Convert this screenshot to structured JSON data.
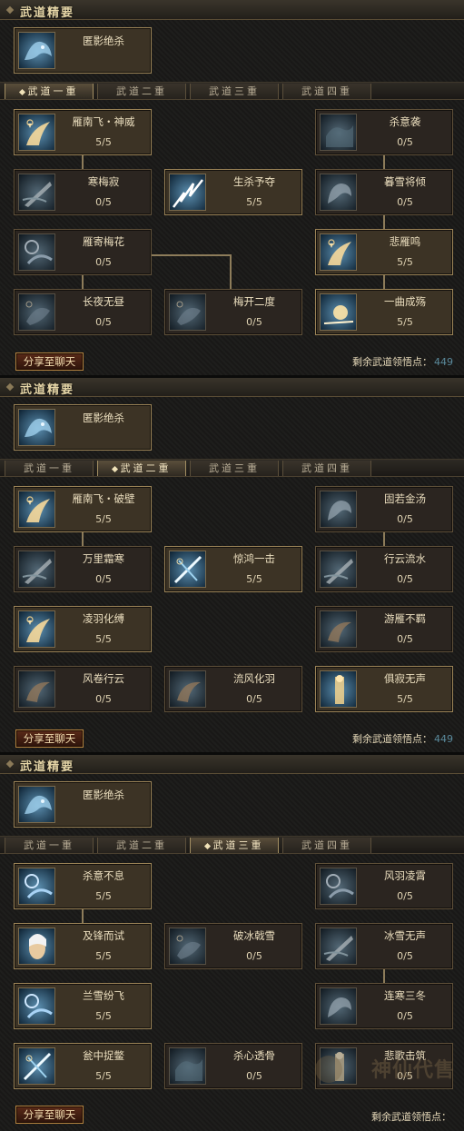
{
  "sections": [
    {
      "header": "武道精要",
      "main_skill": {
        "name": "匿影绝杀",
        "icon": "shadow-wolf-icon"
      },
      "tabs": [
        "武道一重",
        "武道二重",
        "武道三重",
        "武道四重"
      ],
      "active_tab": 0,
      "nodes": [
        {
          "name": "雁南飞・神威",
          "level": "5/5",
          "icon": "flying-wing-icon",
          "maxed": true
        },
        {
          "name": "寒梅寂",
          "level": "0/5",
          "icon": "frost-blade-icon",
          "maxed": false
        },
        {
          "name": "雁寄梅花",
          "level": "0/5",
          "icon": "moon-blade-icon",
          "maxed": false
        },
        {
          "name": "长夜无昼",
          "level": "0/5",
          "icon": "dark-swirl-icon",
          "maxed": false
        },
        {
          "name": "生杀予夺",
          "level": "5/5",
          "icon": "ice-shard-icon",
          "maxed": true
        },
        {
          "name": "梅开二度",
          "level": "0/5",
          "icon": "dark-swirl-icon",
          "maxed": false
        },
        {
          "name": "杀意袭",
          "level": "0/5",
          "icon": "blue-mist-icon",
          "maxed": false
        },
        {
          "name": "暮雪将倾",
          "level": "0/5",
          "icon": "blue-beast-icon",
          "maxed": false
        },
        {
          "name": "悲雁鸣",
          "level": "5/5",
          "icon": "flying-wing-icon",
          "maxed": true
        },
        {
          "name": "一曲成殇",
          "level": "5/5",
          "icon": "golden-burst-icon",
          "maxed": true
        }
      ],
      "share_label": "分享至聊天",
      "points_label": "剩余武道领悟点：",
      "points_value": "449"
    },
    {
      "header": "武道精要",
      "main_skill": {
        "name": "匿影绝杀",
        "icon": "shadow-wolf-icon"
      },
      "tabs": [
        "武道一重",
        "武道二重",
        "武道三重",
        "武道四重"
      ],
      "active_tab": 1,
      "nodes": [
        {
          "name": "雁南飞・破壁",
          "level": "5/5",
          "icon": "flying-wing-icon",
          "maxed": true
        },
        {
          "name": "万里霜寒",
          "level": "0/5",
          "icon": "frost-blade-icon",
          "maxed": false
        },
        {
          "name": "凌羽化缚",
          "level": "5/5",
          "icon": "flying-wing-icon",
          "maxed": true
        },
        {
          "name": "风卷行云",
          "level": "0/5",
          "icon": "fire-swirl-icon",
          "maxed": false
        },
        {
          "name": "惊鸿一击",
          "level": "5/5",
          "icon": "ice-slash-icon",
          "maxed": true
        },
        {
          "name": "流风化羽",
          "level": "0/5",
          "icon": "fire-swirl-icon",
          "maxed": false
        },
        {
          "name": "固若金汤",
          "level": "0/5",
          "icon": "blue-beast-icon",
          "maxed": false
        },
        {
          "name": "行云流水",
          "level": "0/5",
          "icon": "frost-blade-icon",
          "maxed": false
        },
        {
          "name": "游雁不羁",
          "level": "0/5",
          "icon": "fire-swirl-icon",
          "maxed": false
        },
        {
          "name": "俱寂无声",
          "level": "5/5",
          "icon": "golden-figure-icon",
          "maxed": true
        }
      ],
      "share_label": "分享至聊天",
      "points_label": "剩余武道领悟点：",
      "points_value": "449"
    },
    {
      "header": "武道精要",
      "main_skill": {
        "name": "匿影绝杀",
        "icon": "shadow-wolf-icon"
      },
      "tabs": [
        "武道一重",
        "武道二重",
        "武道三重",
        "武道四重"
      ],
      "active_tab": 2,
      "nodes": [
        {
          "name": "杀意不息",
          "level": "5/5",
          "icon": "moon-blade-icon",
          "maxed": true
        },
        {
          "name": "及锋而试",
          "level": "5/5",
          "icon": "warrior-face-icon",
          "maxed": true
        },
        {
          "name": "兰雪纷飞",
          "level": "5/5",
          "icon": "moon-blade-icon",
          "maxed": true
        },
        {
          "name": "瓮中捉鳖",
          "level": "5/5",
          "icon": "ice-slash-icon",
          "maxed": true
        },
        {
          "name": "破冰戟雪",
          "level": "0/5",
          "icon": "dark-swirl-icon",
          "maxed": false
        },
        {
          "name": "杀心透骨",
          "level": "0/5",
          "icon": "blue-mist-icon",
          "maxed": false
        },
        {
          "name": "风羽凌霄",
          "level": "0/5",
          "icon": "moon-blade-icon",
          "maxed": false
        },
        {
          "name": "冰雪无声",
          "level": "0/5",
          "icon": "frost-blade-icon",
          "maxed": false
        },
        {
          "name": "连寒三冬",
          "level": "0/5",
          "icon": "blue-beast-icon",
          "maxed": false
        },
        {
          "name": "悲歌击筑",
          "level": "0/5",
          "icon": "golden-figure-icon",
          "maxed": false
        }
      ],
      "share_label": "分享至聊天",
      "points_label": "剩余武道领悟点：",
      "points_value": ""
    }
  ],
  "watermark": "神仙代售",
  "colors": {
    "accent": "#9c8457",
    "points_value": "#5a8a9c",
    "share_button": "#5a2a18"
  }
}
